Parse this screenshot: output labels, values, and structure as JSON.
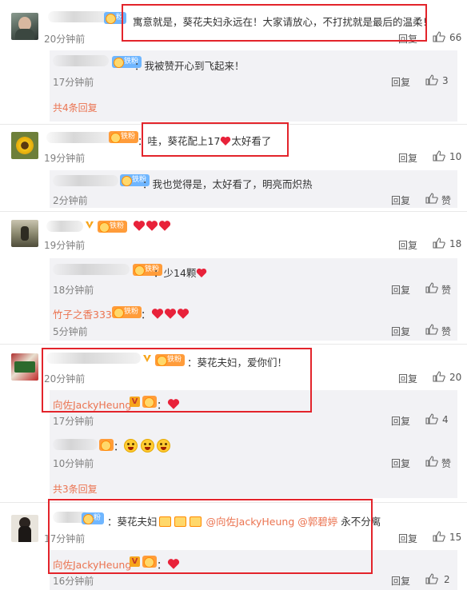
{
  "colors": {
    "accent": "#eb7350",
    "highlight_box": "#e3242b",
    "heart": "#e8223a"
  },
  "common": {
    "reply_label": "回复",
    "like_label": "赞"
  },
  "threads": [
    {
      "comment": {
        "text": "寓意就是，葵花夫妇永远在！大家请放心，不打扰就是最后的温柔！",
        "time": "20分钟前",
        "likes": "66"
      },
      "replies": [
        {
          "text": "：我被赞开心到飞起来！",
          "time": "17分钟前"
        }
      ],
      "more": "共4条回复"
    },
    {
      "comment": {
        "text": "：哇，葵花配上17",
        "text_after": "太好看了",
        "time": "19分钟前",
        "likes": "10"
      },
      "replies": [
        {
          "text": "：我也觉得是，太好看了，明亮而炽热",
          "time": "2分钟前"
        }
      ]
    },
    {
      "comment": {
        "text": "",
        "time": "19分钟前",
        "likes": "18"
      },
      "replies": [
        {
          "text": "：少14颗",
          "time": "18分钟前"
        },
        {
          "name": "竹子之香333",
          "text": "：",
          "time": "5分钟前"
        }
      ]
    },
    {
      "comment": {
        "text": "：葵花夫妇，爱你们！",
        "time": "20分钟前",
        "likes": "20"
      },
      "replies": [
        {
          "name": "向佐JackyHeung",
          "text": "：",
          "time": "17分钟前"
        },
        {
          "text": "：",
          "time": "10分钟前"
        }
      ],
      "more": "共3条回复"
    },
    {
      "comment": {
        "text": "：葵花夫妇",
        "mention1": "@向佐JackyHeung",
        "mention2": "@郭碧婷",
        "text_after": "永不分离",
        "time": "17分钟前",
        "likes": "15"
      },
      "replies": [
        {
          "name": "向佐JackyHeung",
          "text": "：",
          "time": "16分钟前",
          "likes": "2"
        }
      ]
    }
  ],
  "badges": {
    "iron_fan": "铁粉",
    "fan": "粉"
  },
  "icons": [
    "like-icon",
    "heart-emoji",
    "grin-emoji",
    "v-badge",
    "fan-level-icon"
  ]
}
